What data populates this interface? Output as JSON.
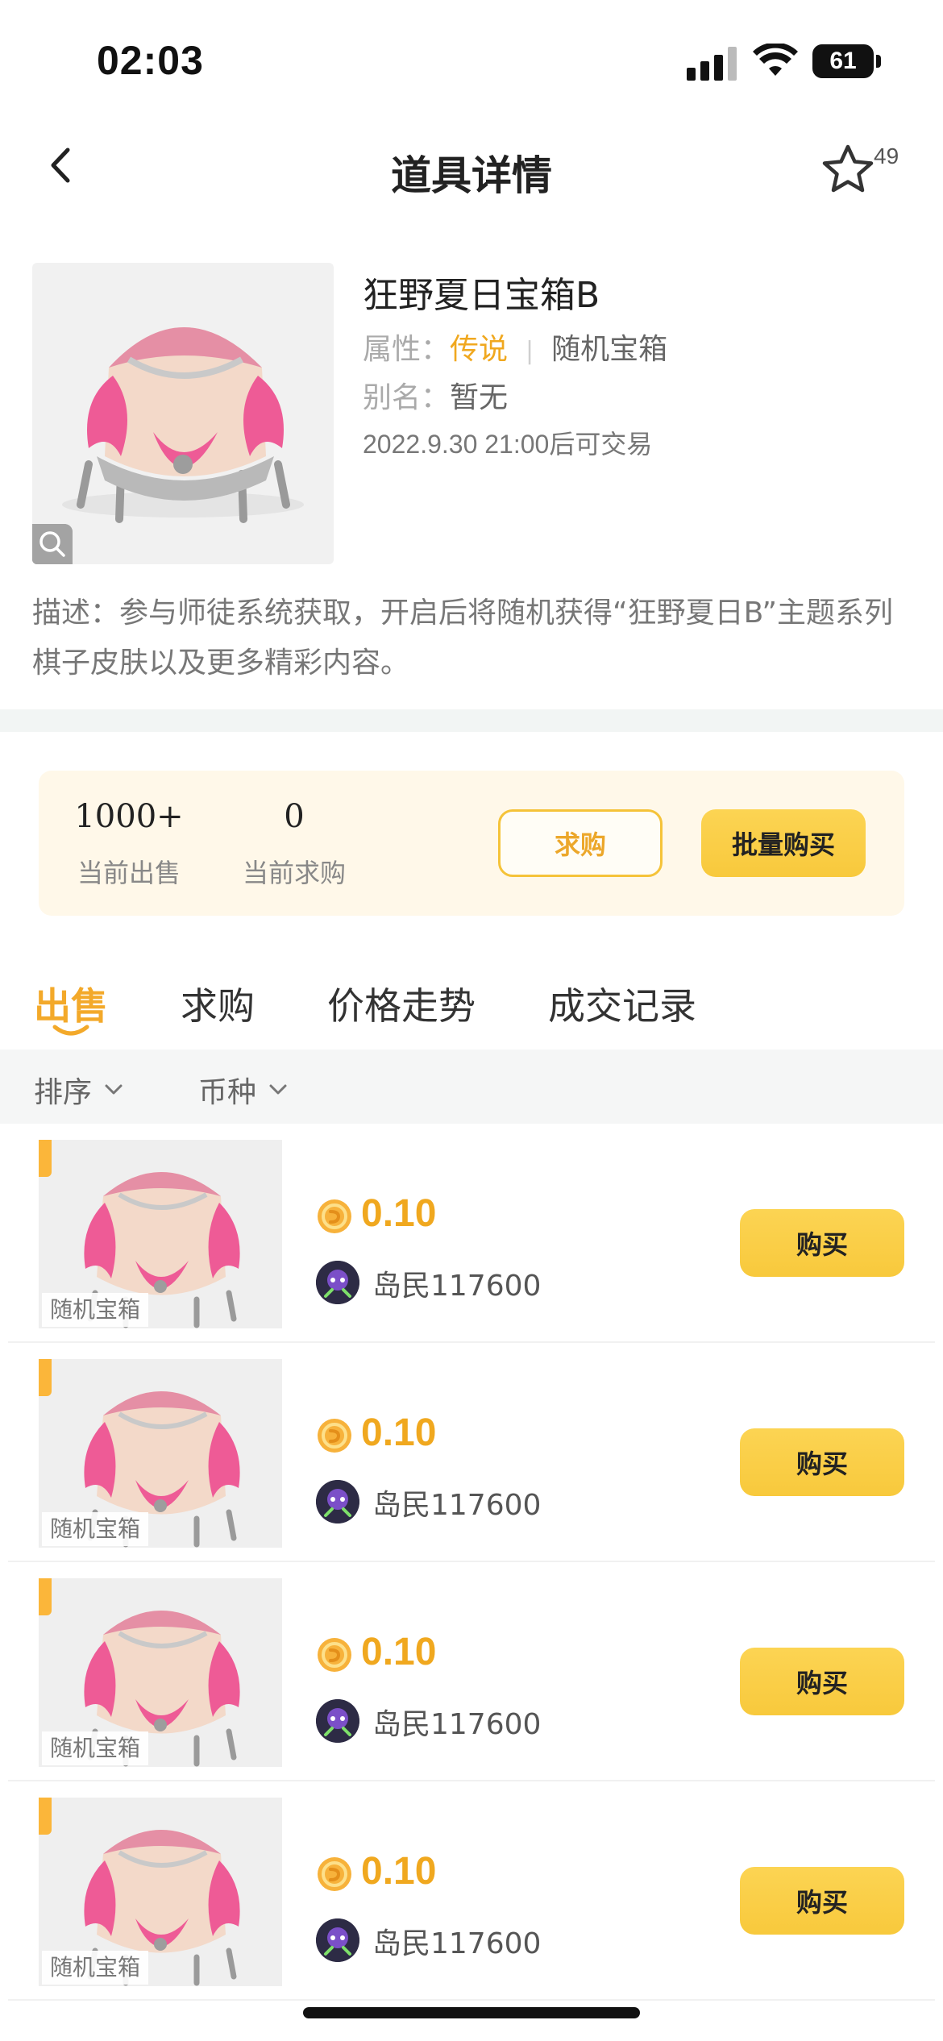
{
  "status_bar": {
    "time": "02:03",
    "battery": "61"
  },
  "nav": {
    "title": "道具详情",
    "favorite_count": "49"
  },
  "item": {
    "name": "狂野夏日宝箱B",
    "attribute_label": "属性：",
    "rarity": "传说",
    "category": "随机宝箱",
    "alias_label": "别名：",
    "alias": "暂无",
    "trade_time": "2022.9.30 21:00后可交易",
    "description": "描述：参与师徒系统获取，开启后将随机获得“狂野夏日B”主题系列棋子皮肤以及更多精彩内容。"
  },
  "stats": {
    "on_sale_count": "1000+",
    "on_sale_label": "当前出售",
    "wanted_count": "0",
    "wanted_label": "当前求购",
    "wish_button": "求购",
    "bulk_button": "批量购买"
  },
  "tabs": [
    {
      "label": "出售",
      "active": true
    },
    {
      "label": "求购",
      "active": false
    },
    {
      "label": "价格走势",
      "active": false
    },
    {
      "label": "成交记录",
      "active": false
    }
  ],
  "filters": {
    "sort": "排序",
    "currency": "币种"
  },
  "listings": [
    {
      "tag": "随机宝箱",
      "price": "0.10",
      "seller": "岛民117600",
      "buy": "购买"
    },
    {
      "tag": "随机宝箱",
      "price": "0.10",
      "seller": "岛民117600",
      "buy": "购买"
    },
    {
      "tag": "随机宝箱",
      "price": "0.10",
      "seller": "岛民117600",
      "buy": "购买"
    },
    {
      "tag": "随机宝箱",
      "price": "0.10",
      "seller": "岛民117600",
      "buy": "购买"
    }
  ],
  "colors": {
    "accent": "#f0a81f",
    "button_yellow": "#f8c93c",
    "card_bg": "#fff8e9"
  },
  "icons": [
    "back-arrow-icon",
    "star-outline-icon",
    "zoom-icon",
    "chevron-down-icon",
    "coin-icon"
  ]
}
